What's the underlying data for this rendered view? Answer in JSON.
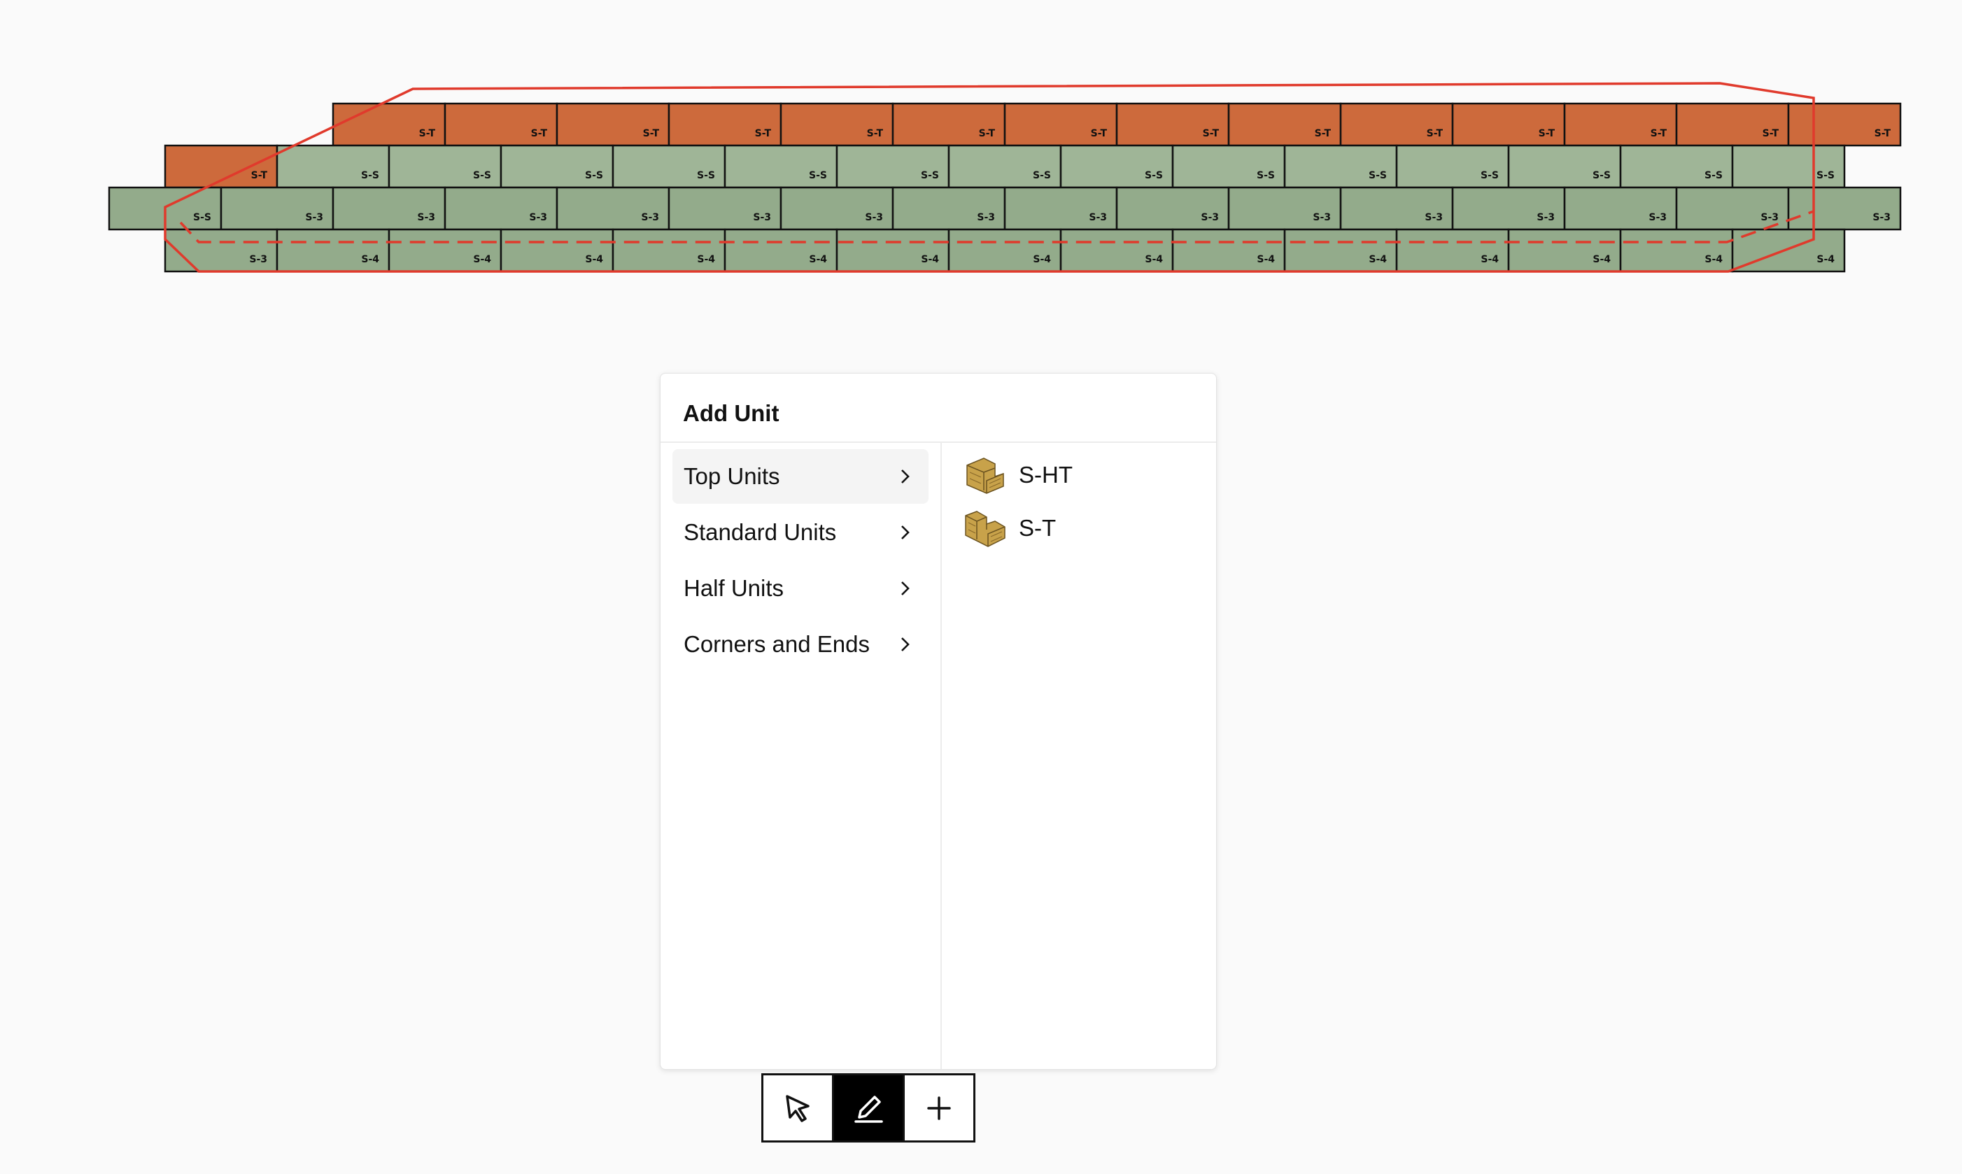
{
  "wall": {
    "rows": [
      {
        "label": "S-T",
        "color": "#cd6a3c"
      },
      {
        "label": "S-S",
        "color": "#9fb597"
      },
      {
        "label": "S-3",
        "color": "#93ab8b"
      },
      {
        "label": "S-4",
        "color": "#93ab8b"
      }
    ],
    "corner_label": "S-T",
    "end_left_label": "S-S",
    "end_bottom_label": "S-3",
    "selection_color": "#e03a2c"
  },
  "panel": {
    "title": "Add Unit",
    "categories": [
      {
        "label": "Top Units",
        "active": true
      },
      {
        "label": "Standard Units",
        "active": false
      },
      {
        "label": "Half Units",
        "active": false
      },
      {
        "label": "Corners and Ends",
        "active": false
      }
    ],
    "units": [
      {
        "label": "S-HT",
        "icon": "block-unit-icon"
      },
      {
        "label": "S-T",
        "icon": "block-unit-icon"
      }
    ]
  },
  "toolbar": {
    "tools": [
      {
        "name": "select",
        "icon": "cursor-arrow-icon",
        "active": false
      },
      {
        "name": "draw",
        "icon": "pen-icon",
        "active": true
      },
      {
        "name": "add",
        "icon": "plus-icon",
        "active": false
      }
    ]
  },
  "colors": {
    "top_unit": "#cd6a3c",
    "standard_unit": "#9fb597",
    "accent_outline": "#e03a2c",
    "unit_icon": "#c8a24a"
  }
}
